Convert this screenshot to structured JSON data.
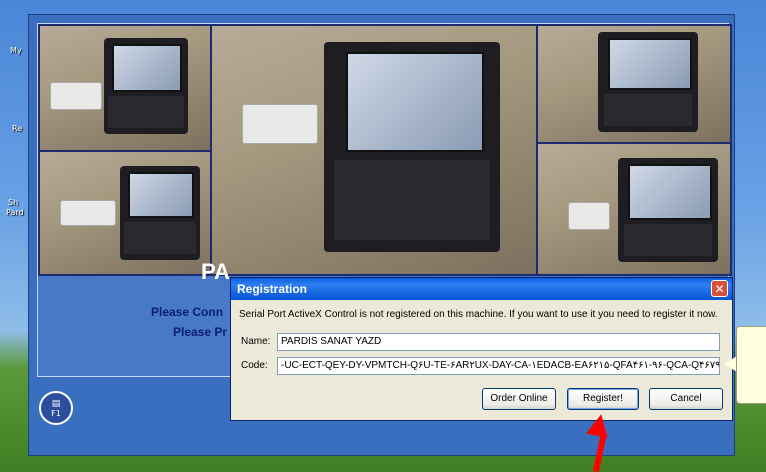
{
  "desktop": {
    "icon_labels": [
      "My",
      "Re",
      "Sh",
      "Pard"
    ]
  },
  "app": {
    "title_partial": "PA",
    "title_tail": "PARDIS KEY PROGRAMMER",
    "line1": "Please Conn",
    "line2": "Please Pr",
    "f1_label": "F1"
  },
  "dialog": {
    "title": "Registration",
    "message": "Serial Port ActiveX Control is not registered on this machine. If you want to use it you need to register it now.",
    "name_label": "Name:",
    "name_value": "PARDIS SANAT YAZD",
    "code_label": "Code:",
    "code_value": "-UC-ECT-QEY-DY-VPMTCH-Q۶U-TE-۶AR۲UX-DAY-CA-۱EDACB-EA۶۲۱۵-QFA۴۶۱-۹۶-QCA-Q۴۶۷۹۲",
    "buttons": {
      "order": "Order Online",
      "register": "Register!",
      "cancel": "Cancel"
    },
    "close_glyph": "✕"
  }
}
